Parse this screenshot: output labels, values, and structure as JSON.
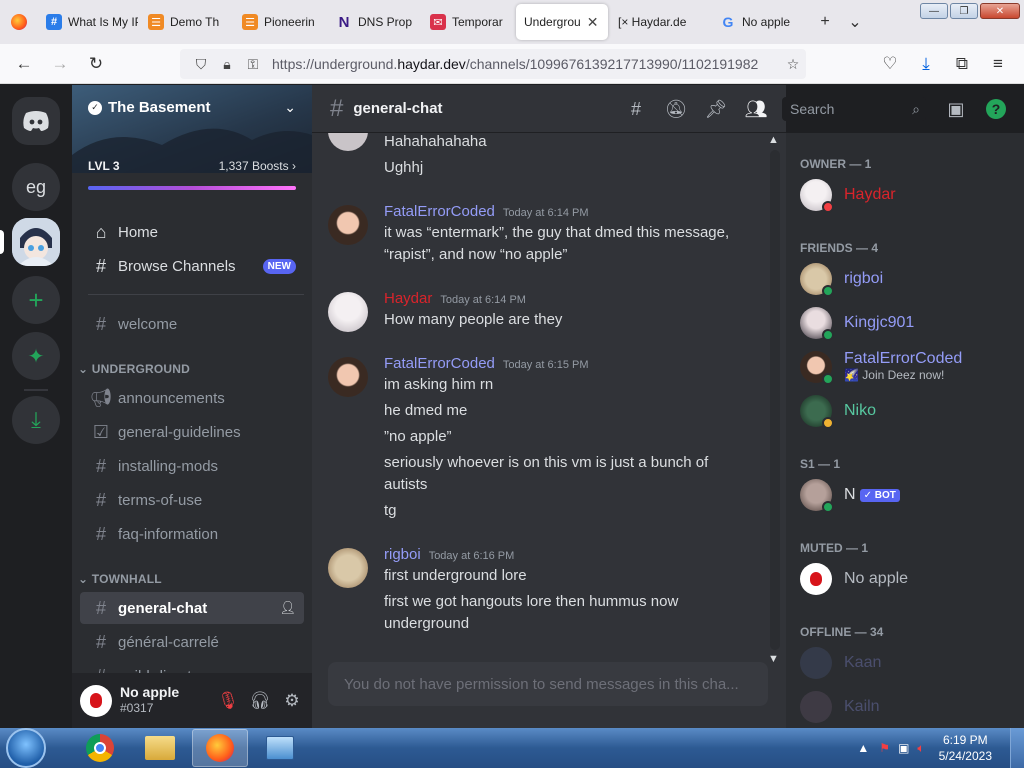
{
  "browser": {
    "tabs": [
      {
        "label": "What Is My IP",
        "favicon": "#",
        "fav_color": "#2b7de9"
      },
      {
        "label": "Demo Th",
        "favicon": "☰",
        "fav_color": "#f08a24"
      },
      {
        "label": "Pioneerin",
        "favicon": "☰",
        "fav_color": "#f08a24"
      },
      {
        "label": "DNS Prop",
        "favicon": "N",
        "fav_color": "#3b1b85"
      },
      {
        "label": "Temporar",
        "favicon": "✉",
        "fav_color": "#d9324b"
      },
      {
        "label": "Undergrou",
        "favicon": "",
        "fav_color": "#ffffff"
      },
      {
        "label": "[× Haydar.de",
        "favicon": "",
        "fav_color": "#e8e7ec"
      },
      {
        "label": "No apple",
        "favicon": "G",
        "fav_color": "#4285f4"
      }
    ],
    "new_tab": "+",
    "tab_list": "⌄",
    "url_prefix": "https://underground.",
    "url_domain": "haydar.dev",
    "url_path": "/channels/1099676139217713990/1102191982",
    "window_controls": [
      "—",
      "❐",
      "✕"
    ]
  },
  "server": {
    "name": "The Basement",
    "level": "LVL 3",
    "boosts": "1,337 Boosts",
    "boosts_arrow": "›",
    "home": "Home",
    "browse": "Browse Channels",
    "new_badge": "NEW",
    "welcome": "welcome",
    "categories": {
      "underground": "UNDERGROUND",
      "townhall": "TOWNHALL"
    },
    "underground_channels": [
      "announcements",
      "general-guidelines",
      "installing-mods",
      "terms-of-use",
      "faq-information"
    ],
    "townhall_channels": [
      "general-chat",
      "général-carrelé",
      "guild-directory"
    ]
  },
  "guild_bar": {
    "eg_label": "eg",
    "add": "+",
    "explore": "✦",
    "download": "⤓"
  },
  "user": {
    "name": "No apple",
    "tag": "#0317"
  },
  "channel": {
    "name": "general-chat",
    "hash": "#",
    "search_placeholder": "Search"
  },
  "messages": [
    {
      "lines": [
        "Hahahahahaha",
        "Ughhj"
      ]
    },
    {
      "author": "FatalErrorCoded",
      "color": "#949cf7",
      "time": "Today at 6:14 PM",
      "lines": [
        "it was “entermark”, the guy that dmed this message, “rapist”, and now “no apple”"
      ]
    },
    {
      "author": "Haydar",
      "color": "#d9242b",
      "time": "Today at 6:14 PM",
      "lines": [
        "How many people are they"
      ]
    },
    {
      "author": "FatalErrorCoded",
      "color": "#949cf7",
      "time": "Today at 6:15 PM",
      "lines": [
        "im asking him rn",
        "he dmed me",
        "”no apple”",
        "seriously whoever is on this vm is just a bunch of autists",
        "tg"
      ]
    },
    {
      "author": "rigboi",
      "color": "#949cf7",
      "time": "Today at 6:16 PM",
      "lines": [
        "first underground lore",
        "first we got hangouts lore then hummus now underground"
      ]
    }
  ],
  "composer_placeholder": "You do not have permission to send messages in this cha...",
  "members": {
    "owner_header": "OWNER — 1",
    "friends_header": "FRIENDS — 4",
    "s1_header": "S1 — 1",
    "muted_header": "MUTED — 1",
    "offline_header": "OFFLINE — 34",
    "owner": [
      {
        "name": "Haydar",
        "color": "#d9242b"
      }
    ],
    "friends": [
      {
        "name": "rigboi",
        "color": "#949cf7"
      },
      {
        "name": "Kingjc901",
        "color": "#949cf7"
      },
      {
        "name": "FatalErrorCoded",
        "color": "#949cf7",
        "status_text": "🌠 Join Deez now!"
      },
      {
        "name": "Niko",
        "color": "#57c8a0"
      }
    ],
    "s1": [
      {
        "name": "N",
        "badge": "✓ BOT"
      }
    ],
    "muted": [
      {
        "name": "No apple"
      }
    ],
    "offline": [
      {
        "name": "Kaan"
      },
      {
        "name": "Kailn"
      }
    ]
  },
  "taskbar": {
    "time": "6:19 PM",
    "date": "5/24/2023"
  }
}
